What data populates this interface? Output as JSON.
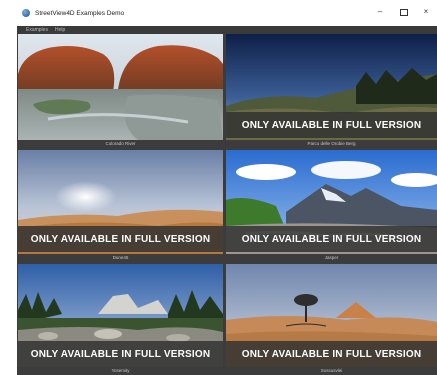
{
  "window": {
    "title": "StreetView4D Examples Demo",
    "minimize": "–",
    "maximize": "",
    "close": "×"
  },
  "menu": {
    "items": [
      "Examples",
      "Help"
    ]
  },
  "tiles": [
    {
      "label": "Colorado River",
      "banner": ""
    },
    {
      "label": "Parco delle Orobie Berg",
      "banner": "ONLY AVAILABLE IN FULL VERSION"
    },
    {
      "label": "Dune45",
      "banner": "ONLY AVAILABLE IN FULL VERSION"
    },
    {
      "label": "Jasper",
      "banner": "ONLY AVAILABLE IN FULL VERSION"
    },
    {
      "label": "Yosemity",
      "banner": "ONLY AVAILABLE IN FULL VERSION"
    },
    {
      "label": "Sossusvlei",
      "banner": "ONLY AVAILABLE IN FULL VERSION"
    }
  ]
}
